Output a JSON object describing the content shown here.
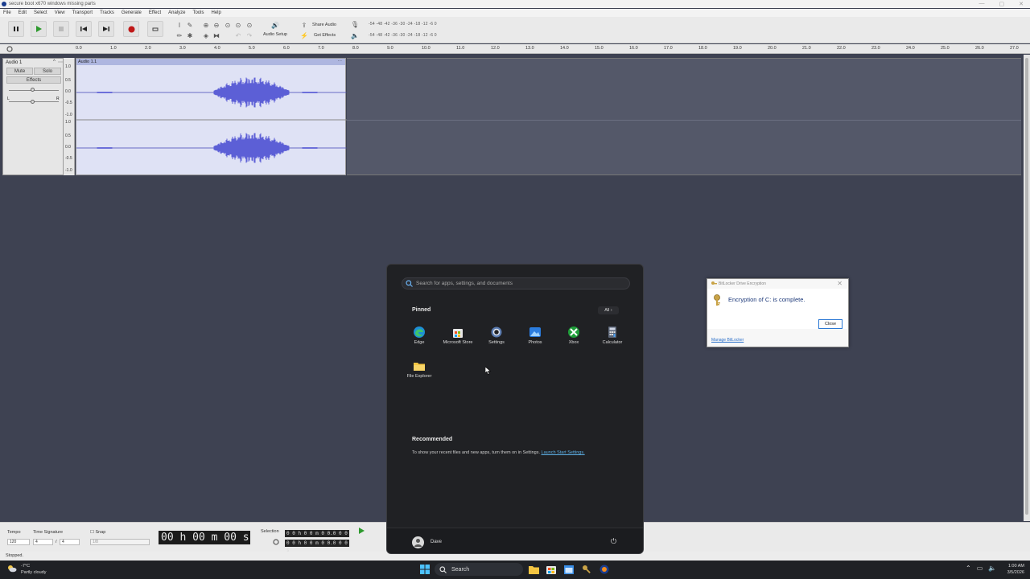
{
  "window": {
    "title": "secure boot x670 windows missing parts",
    "controls": [
      "—",
      "▢",
      "✕"
    ]
  },
  "menu": [
    "File",
    "Edit",
    "Select",
    "View",
    "Transport",
    "Tracks",
    "Generate",
    "Effect",
    "Analyze",
    "Tools",
    "Help"
  ],
  "toolbar": {
    "audio_setup": "Audio Setup",
    "share_audio": "Share Audio",
    "get_effects": "Get Effects",
    "meter_rec": "-54 -48 -42 -36 -30 -24 -18 -12 -6 0",
    "meter_play": "-54 -48 -42 -36 -30 -24 -18 -12 -6 0"
  },
  "ruler": [
    "0.0",
    "1.0",
    "2.0",
    "3.0",
    "4.0",
    "5.0",
    "6.0",
    "7.0",
    "8.0",
    "9.0",
    "10.0",
    "11.0",
    "12.0",
    "13.0",
    "14.0",
    "15.0",
    "16.0",
    "17.0",
    "18.0",
    "19.0",
    "20.0",
    "21.0",
    "22.0",
    "23.0",
    "24.0",
    "25.0",
    "26.0",
    "27.0"
  ],
  "track": {
    "name": "Audio 1",
    "mute": "Mute",
    "solo": "Solo",
    "effects": "Effects",
    "pan_l": "L",
    "pan_r": "R",
    "clip_name": "Audio 1.1",
    "scale": [
      "1.0",
      "0.5",
      "0.0",
      "-0.5",
      "-1.0",
      "1.0",
      "0.5",
      "0.0",
      "-0.5",
      "-1.0"
    ]
  },
  "bottom": {
    "tempo_label": "Tempo",
    "tempo_value": "120",
    "timesig_label": "Time Signature",
    "timesig_num": "4",
    "timesig_den": "4",
    "timesig_sep": "/",
    "snap_label": "Snap",
    "snap_value": "1/8",
    "time_display": "00 h 00 m 00 s",
    "selection_label": "Selection",
    "selection_start": "0 0 h 0 0 m 0 0.0 0 0 s",
    "selection_end": "0 0 h 0 0 m 0 0.0 0 0 s",
    "status": "Stopped."
  },
  "start_menu": {
    "search_placeholder": "Search for apps, settings, and documents",
    "pinned_title": "Pinned",
    "all_label": "All ›",
    "pinned": [
      {
        "name": "Edge",
        "icon": "edge-icon"
      },
      {
        "name": "Microsoft Store",
        "icon": "store-icon"
      },
      {
        "name": "Settings",
        "icon": "gear-icon"
      },
      {
        "name": "Photos",
        "icon": "photos-icon"
      },
      {
        "name": "Xbox",
        "icon": "xbox-icon"
      },
      {
        "name": "Calculator",
        "icon": "calculator-icon"
      },
      {
        "name": "File Explorer",
        "icon": "folder-icon"
      }
    ],
    "recommended_title": "Recommended",
    "recommended_text": "To show your recent files and new apps, turn them on in Settings.",
    "recommended_link": "Launch Start Settings.",
    "user_name": "Dave"
  },
  "bitlocker": {
    "title": "BitLocker Drive Encryption",
    "message": "Encryption of C: is complete.",
    "close_button": "Close",
    "manage_link": "Manage BitLocker"
  },
  "taskbar": {
    "weather_temp": "-7°C",
    "weather_desc": "Partly cloudy",
    "search_label": "Search",
    "time": "1:00 AM",
    "date": "3/5/2026"
  },
  "colors": {
    "accent_blue": "#2a78d4",
    "waveform": "#5c5fd6",
    "track_bg": "#3e4252",
    "startmenu_bg": "#202124"
  }
}
